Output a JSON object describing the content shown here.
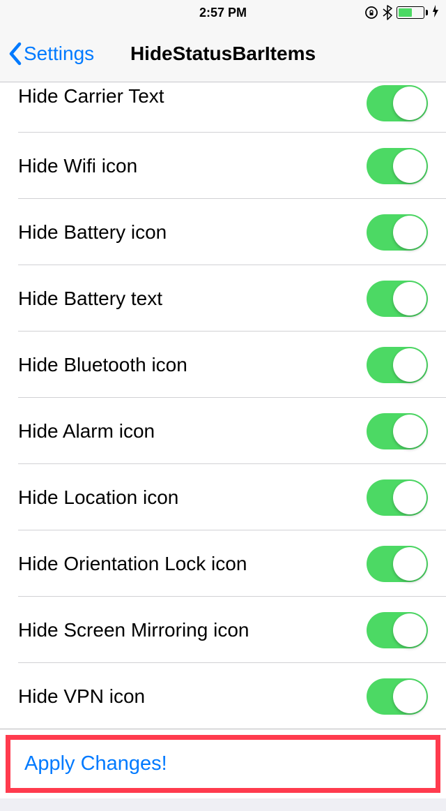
{
  "statusbar": {
    "time": "2:57 PM"
  },
  "nav": {
    "back": "Settings",
    "title": "HideStatusBarItems"
  },
  "items": [
    {
      "label": "Hide Carrier Text"
    },
    {
      "label": "Hide Wifi icon"
    },
    {
      "label": "Hide Battery icon"
    },
    {
      "label": "Hide Battery text"
    },
    {
      "label": "Hide Bluetooth icon"
    },
    {
      "label": "Hide Alarm icon"
    },
    {
      "label": "Hide Location icon"
    },
    {
      "label": "Hide Orientation Lock icon"
    },
    {
      "label": "Hide Screen Mirroring icon"
    },
    {
      "label": "Hide VPN icon"
    }
  ],
  "apply": {
    "label": "Apply Changes!"
  }
}
